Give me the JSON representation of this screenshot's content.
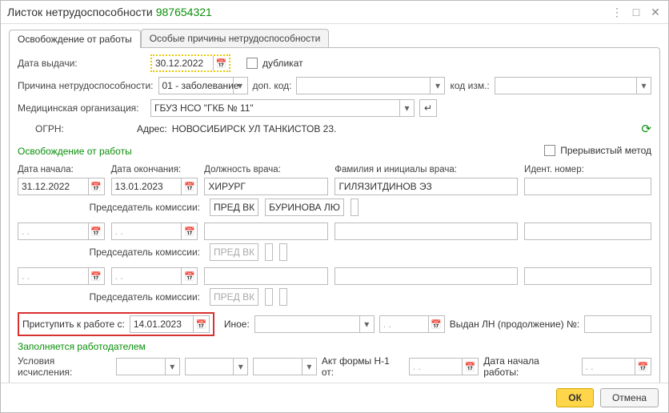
{
  "header": {
    "title_prefix": "Листок нетрудоспособности",
    "number": "987654321"
  },
  "tabs": {
    "main": "Освобождение от работы",
    "special": "Особые причины нетрудоспособности"
  },
  "fields": {
    "issue_date_label": "Дата выдачи:",
    "issue_date": "30.12.2022",
    "duplicate_label": "дубликат",
    "reason_label": "Причина нетрудоспособности:",
    "reason_value": "01 - заболевание",
    "dop_code_label": "доп. код:",
    "code_change_label": "код изм.:",
    "med_org_label": "Медицинская организация:",
    "med_org_value": "ГБУЗ НСО \"ГКБ № 11\"",
    "ogrn_label": "ОГРН:",
    "address_label": "Адрес:",
    "address_value": "НОВОСИБИРСК УЛ ТАНКИСТОВ 23."
  },
  "section_release_title": "Освобождение от работы",
  "intermittent_label": "Прерывистый метод",
  "grid": {
    "headers": {
      "start": "Дата начала:",
      "end": "Дата окончания:",
      "post": "Должность врача:",
      "fio": "Фамилия и инициалы врача:",
      "ident": "Идент. номер:"
    },
    "chairman_label": "Председатель комиссии:",
    "placeholder_date": " .   .   ",
    "placeholder_chair": "ПРЕД ВК",
    "rows": [
      {
        "start": "31.12.2022",
        "end": "13.01.2023",
        "post": "ХИРУРГ",
        "fio": "ГИЛЯЗИТДИНОВ ЭЗ",
        "ident": "",
        "chair_post": "ПРЕД ВК",
        "chair_fio": "БУРИНОВА ЛЮ",
        "chair_ident": ""
      },
      {
        "start": "",
        "end": "",
        "post": "",
        "fio": "",
        "ident": "",
        "chair_post": "",
        "chair_fio": "",
        "chair_ident": ""
      },
      {
        "start": "",
        "end": "",
        "post": "",
        "fio": "",
        "ident": "",
        "chair_post": "",
        "chair_fio": "",
        "chair_ident": ""
      }
    ]
  },
  "return_row": {
    "label": "Приступить к работе с:",
    "date": "14.01.2023",
    "other_label": "Иное:",
    "issued_label": "Выдан ЛН (продолжение) №:"
  },
  "employer_section": {
    "title": "Заполняется работодателем",
    "calc_label": "Условия исчисления:",
    "act_label": "Акт формы Н-1 от:",
    "work_start_label": "Дата начала работы:"
  },
  "footer": {
    "ok": "ОК",
    "cancel": "Отмена"
  }
}
